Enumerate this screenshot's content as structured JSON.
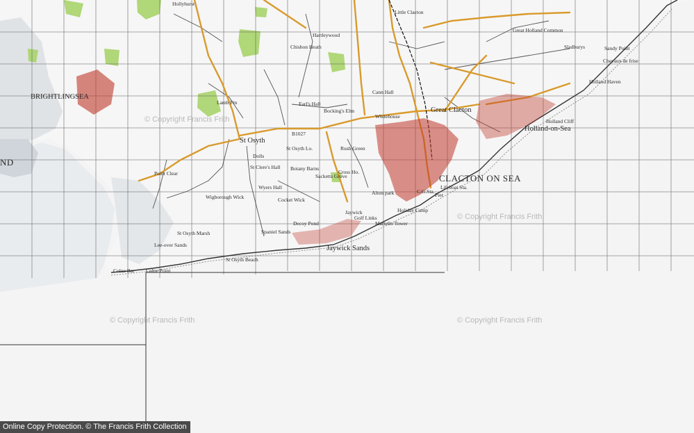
{
  "map": {
    "places": {
      "clacton_on_sea": "CLACTON ON SEA",
      "great_clacton": "Great Clacton",
      "little_clacton": "Little Clacton",
      "holland_on_sea": "Holland-on-Sea",
      "holland_cliff": "Holland Cliff",
      "holland_haven": "Holland Haven",
      "brightlingsea": "BRIGHTLINGSEA",
      "st_osyth": "St Osyth",
      "st_osyth_marsh": "St Osyth Marsh",
      "st_osyth_beach": "St Osyth Beach",
      "st_osyth_lo": "St Osyth Lo.",
      "jaywick_sands": "Jaywick Sands",
      "jaywick": "Jaywick",
      "point_clear": "Point Clear",
      "lee_over_sands": "Lee-over Sands",
      "colne_point": "Colne Point",
      "colne_bar": "Colne Bar",
      "rush_green": "Rush Green",
      "bockings_elm": "Bocking's Elm",
      "earls_hall": "Earl's Hall",
      "chisbon_heath": "Chisbon Heath",
      "hartley_wood": "Hartleywood",
      "wigborough_wick": "Wigborough Wick",
      "cocket_wick": "Cocket Wick",
      "wyers_hall": "Wyers Hall",
      "botany_barns": "Botany Barns",
      "sacketts_grove": "Sacketts Grove",
      "cross_ho": "Cross Ho.",
      "alton_park": "Alton park",
      "holiday_camp": "Holiday Camp",
      "golf_links": "Golf Links",
      "martello_tower": "Martello Tower",
      "decoy_pond": "Decoy Pond",
      "spaniel_sands": "Spaniel Sands",
      "lifeboat_sta": "Lifeboat Sta.",
      "pier": "Pier",
      "cg_sta": "C.G.Sta.",
      "great_holland_common": "Great Holland Common",
      "sladburys": "Sladburys",
      "chevaux_de_frise": "Chevaux de frise",
      "sandy_point": "Sandy Point",
      "cann_hall": "Cann Hall",
      "hollyhurst": "Hollyhurst",
      "lamb_fm": "Lamb Fm",
      "dolls": "Dolls",
      "st_cleres_hall": "St Clere's Hall",
      "whitehouse": "Whitehouse",
      "b1027": "B1027",
      "island_fragment": "ND"
    },
    "colors": {
      "land": "#f3f3f3",
      "sea": "#f5f5f5",
      "urban": "#c0392b",
      "road_major": "#d99a2b",
      "road_minor": "#2b2b2b",
      "woodland": "#a9d46b",
      "marsh": "#cfd3d8",
      "grid": "#5a5a5a"
    },
    "watermarks": [
      "© Copyright Francis Frith",
      "© Copyright Francis Frith",
      "© Copyright Francis Frith",
      "© Copyright Francis Frith"
    ]
  },
  "footer": {
    "text": "Online Copy Protection.  © The Francis Frith Collection"
  }
}
